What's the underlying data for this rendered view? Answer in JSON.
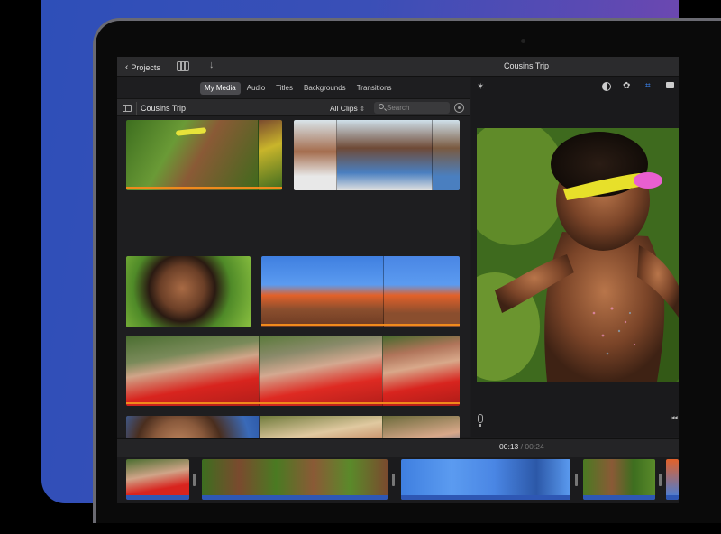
{
  "titlebar": {
    "projects_label": "Projects",
    "app_title": "Cousins Trip",
    "media_icon": "film-music-icon",
    "import_icon": "download-arrow-icon"
  },
  "browser": {
    "tabs": [
      {
        "label": "My Media",
        "active": true
      },
      {
        "label": "Audio",
        "active": false
      },
      {
        "label": "Titles",
        "active": false
      },
      {
        "label": "Backgrounds",
        "active": false
      },
      {
        "label": "Transitions",
        "active": false
      }
    ],
    "event_title": "Cousins Trip",
    "clips_filter": "All Clips",
    "search_placeholder": "Search"
  },
  "timeline": {
    "current_time": "00:13",
    "separator": "/",
    "total_time": "00:24"
  },
  "colors": {
    "accent_blue": "#3d8bff",
    "clip_used_bar": "#f08a1c",
    "audio_track": "#2e57b4"
  }
}
